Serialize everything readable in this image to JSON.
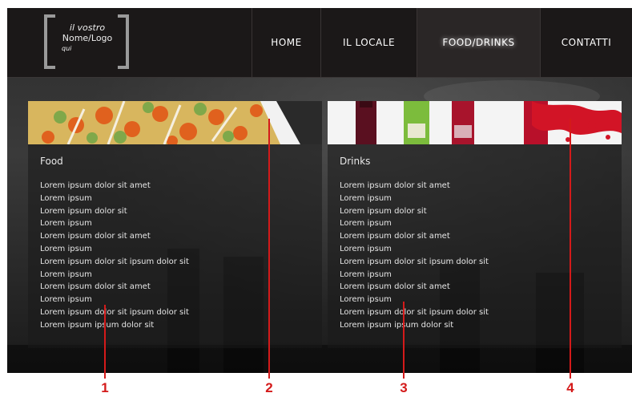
{
  "logo": {
    "line1": "il vostro",
    "line2": "Nome/Logo",
    "line3": "qui"
  },
  "nav": [
    {
      "label": "HOME",
      "active": false,
      "width": 86
    },
    {
      "label": "IL LOCALE",
      "active": false,
      "width": 120
    },
    {
      "label": "FOOD/DRINKS",
      "active": true,
      "width": 154
    },
    {
      "label": "CONTATTI",
      "active": false,
      "width": 115
    }
  ],
  "food": {
    "title": "Food",
    "items": [
      "Lorem ipsum dolor sit amet",
      "Lorem ipsum",
      "Lorem ipsum dolor sit",
      "Lorem ipsum",
      "Lorem ipsum dolor sit amet",
      "Lorem ipsum",
      "Lorem ipsum dolor sit ipsum dolor sit",
      "Lorem ipsum",
      "Lorem ipsum dolor sit amet",
      "Lorem ipsum",
      "Lorem ipsum dolor sit ipsum dolor sit",
      "Lorem ipsum ipsum dolor sit"
    ]
  },
  "drinks": {
    "title": "Drinks",
    "items": [
      "Lorem ipsum dolor sit amet",
      "Lorem ipsum",
      "Lorem ipsum dolor sit",
      "Lorem ipsum",
      "Lorem ipsum dolor sit amet",
      "Lorem ipsum",
      "Lorem ipsum dolor sit ipsum dolor sit",
      "Lorem ipsum",
      "Lorem ipsum dolor sit amet",
      "Lorem ipsum",
      "Lorem ipsum dolor sit ipsum dolor sit",
      "Lorem ipsum ipsum dolor sit"
    ]
  },
  "markers": [
    "1",
    "2",
    "3",
    "4"
  ],
  "colors": {
    "marker": "#d41a1a",
    "header": "#1b1818"
  }
}
